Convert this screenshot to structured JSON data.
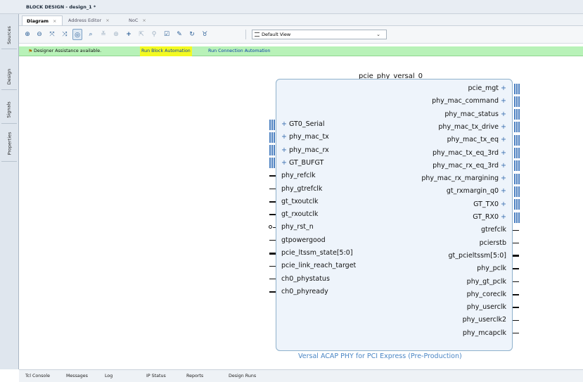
{
  "title": "BLOCK DESIGN - design_1 *",
  "side_tabs": [
    "Sources",
    "Design",
    "Signals",
    "Properties"
  ],
  "tabs": [
    {
      "label": "Diagram",
      "close": "×"
    },
    {
      "label": "Address Editor",
      "close": "×"
    },
    {
      "label": "NoC",
      "close": "×"
    }
  ],
  "toolbar": {
    "icons": [
      "zoom-in-icon",
      "zoom-out-icon",
      "fit-full-icon",
      "fit-selection-icon",
      "auto-fit-icon",
      "search-icon",
      "collapse-icon",
      "expand-icon",
      "add-ip-icon",
      "select-area-icon",
      "add-hierarchy-icon",
      "validate-icon",
      "connection-tool-icon",
      "regenerate-icon",
      "optimize-icon"
    ],
    "view_select": "Default View"
  },
  "assist": {
    "message": "Designer Assistance available.",
    "run_block": "Run Block Automation",
    "run_connection": "Run Connection Automation"
  },
  "ip": {
    "name": "pcie_phy_versal_0",
    "caption": "Versal ACAP PHY for PCI Express (Pre-Production)",
    "left_ports": [
      {
        "label": "GT0_Serial",
        "kind": "interface"
      },
      {
        "label": "phy_mac_tx",
        "kind": "interface"
      },
      {
        "label": "phy_mac_rx",
        "kind": "interface"
      },
      {
        "label": "GT_BUFGT",
        "kind": "interface"
      },
      {
        "label": "phy_refclk",
        "kind": "pin"
      },
      {
        "label": "phy_gtrefclk",
        "kind": "pin"
      },
      {
        "label": "gt_txoutclk",
        "kind": "pin"
      },
      {
        "label": "gt_rxoutclk",
        "kind": "pin"
      },
      {
        "label": "phy_rst_n",
        "kind": "pin-inverted"
      },
      {
        "label": "gtpowergood",
        "kind": "pin"
      },
      {
        "label": "pcie_ltssm_state[5:0]",
        "kind": "bus"
      },
      {
        "label": "pcie_link_reach_target",
        "kind": "pin"
      },
      {
        "label": "ch0_phystatus",
        "kind": "pin"
      },
      {
        "label": "ch0_phyready",
        "kind": "pin"
      }
    ],
    "right_ports": [
      {
        "label": "pcie_mgt",
        "kind": "interface"
      },
      {
        "label": "phy_mac_command",
        "kind": "interface"
      },
      {
        "label": "phy_mac_status",
        "kind": "interface"
      },
      {
        "label": "phy_mac_tx_drive",
        "kind": "interface"
      },
      {
        "label": "phy_mac_tx_eq",
        "kind": "interface"
      },
      {
        "label": "phy_mac_tx_eq_3rd",
        "kind": "interface"
      },
      {
        "label": "phy_mac_rx_eq_3rd",
        "kind": "interface"
      },
      {
        "label": "phy_mac_rx_margining",
        "kind": "interface"
      },
      {
        "label": "gt_rxmargin_q0",
        "kind": "interface"
      },
      {
        "label": "GT_TX0",
        "kind": "interface"
      },
      {
        "label": "GT_RX0",
        "kind": "interface"
      },
      {
        "label": "gtrefclk",
        "kind": "pin"
      },
      {
        "label": "pcierstb",
        "kind": "pin"
      },
      {
        "label": "gt_pcieltssm[5:0]",
        "kind": "bus"
      },
      {
        "label": "phy_pclk",
        "kind": "pin"
      },
      {
        "label": "phy_gt_pclk",
        "kind": "pin"
      },
      {
        "label": "phy_coreclk",
        "kind": "pin"
      },
      {
        "label": "phy_userclk",
        "kind": "pin"
      },
      {
        "label": "phy_userclk2",
        "kind": "pin"
      },
      {
        "label": "phy_mcapclk",
        "kind": "pin"
      }
    ]
  },
  "bottom_tabs": [
    "Tcl Console",
    "Messages",
    "Log",
    "IP Status",
    "Reports",
    "Design Runs"
  ]
}
